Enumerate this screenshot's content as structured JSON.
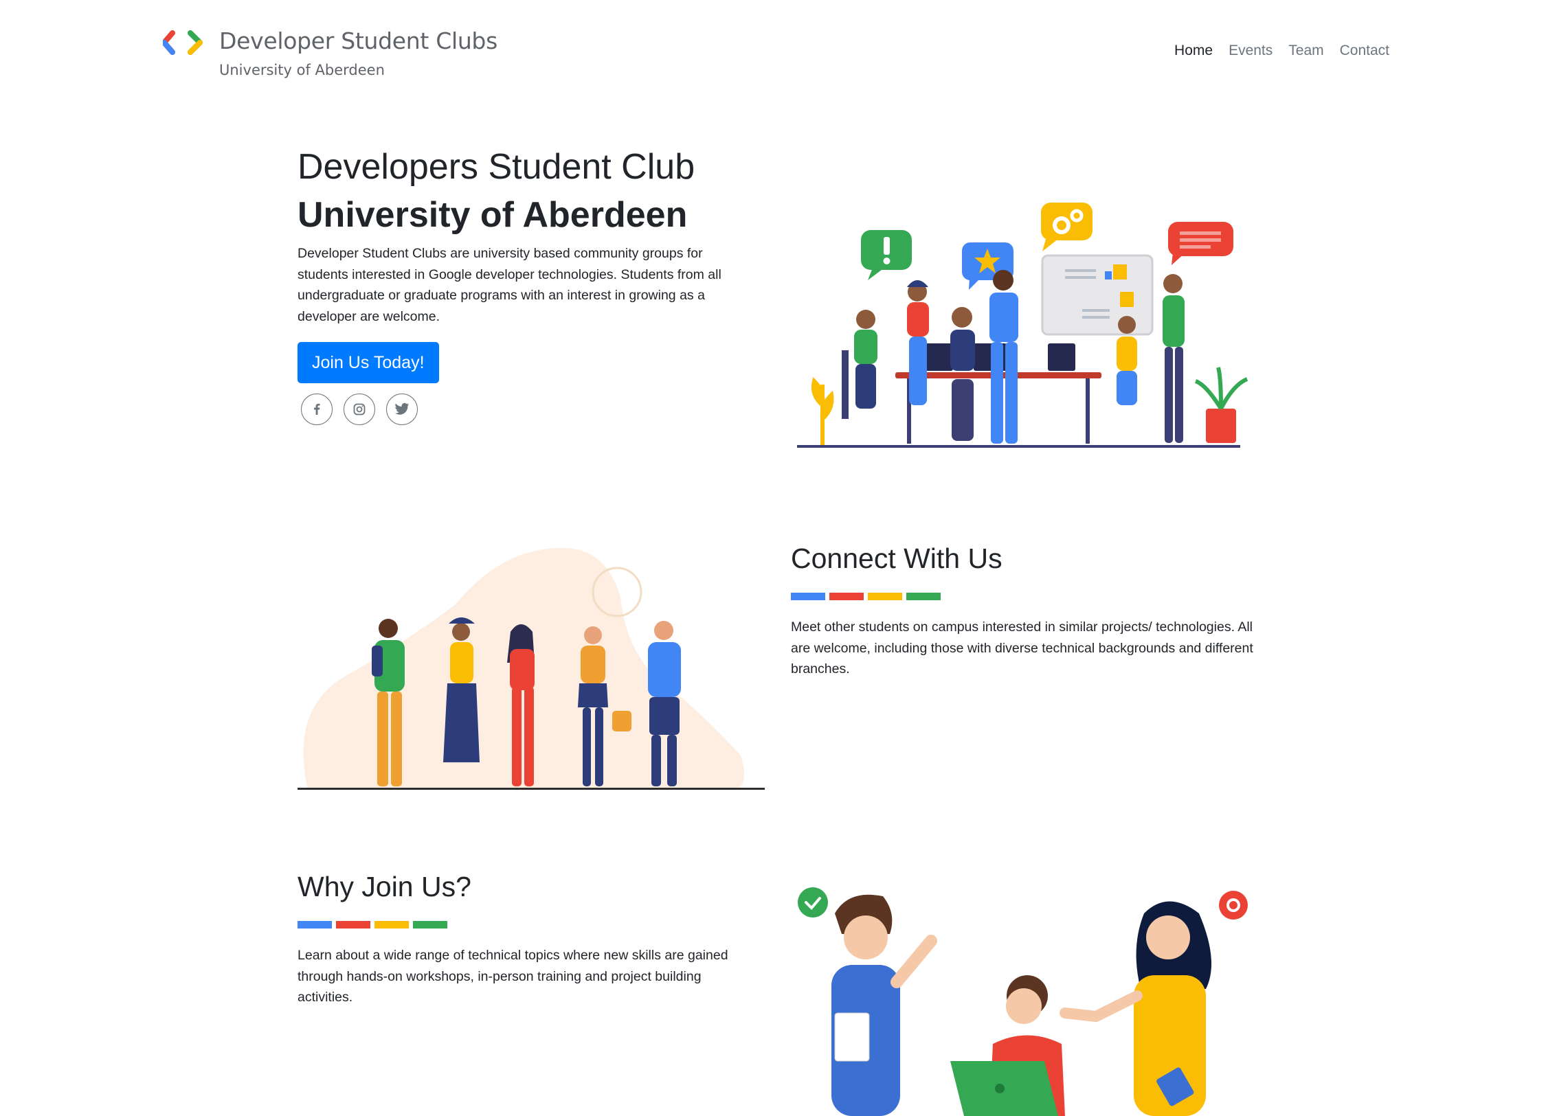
{
  "header": {
    "brand_title": "Developer Student Clubs",
    "brand_subtitle": "University of Aberdeen",
    "logo_icon": "gdsc-brackets-logo",
    "nav": [
      {
        "label": "Home",
        "active": true
      },
      {
        "label": "Events",
        "active": false
      },
      {
        "label": "Team",
        "active": false
      },
      {
        "label": "Contact",
        "active": false
      }
    ]
  },
  "hero": {
    "title": "Developers Student Club",
    "subtitle": "University of Aberdeen",
    "description": "Developer Student Clubs are university based community groups for students interested in Google developer technologies. Students from all undergraduate or graduate programs with an interest in growing as a developer are welcome.",
    "cta_label": "Join Us Today!",
    "social_icons": [
      "facebook-icon",
      "instagram-icon",
      "twitter-icon"
    ]
  },
  "connect": {
    "title": "Connect With Us",
    "description": "Meet other students on campus interested in similar projects/ technologies. All are welcome, including those with diverse technical backgrounds and different branches."
  },
  "why_join": {
    "title": "Why Join Us?",
    "description": "Learn about a wide range of technical topics where new skills are gained through hands-on workshops, in-person training and project building activities."
  },
  "colors": {
    "blue": "#4285f4",
    "red": "#ea4335",
    "yellow": "#fbbc04",
    "green": "#34a853",
    "button": "#007bff"
  }
}
